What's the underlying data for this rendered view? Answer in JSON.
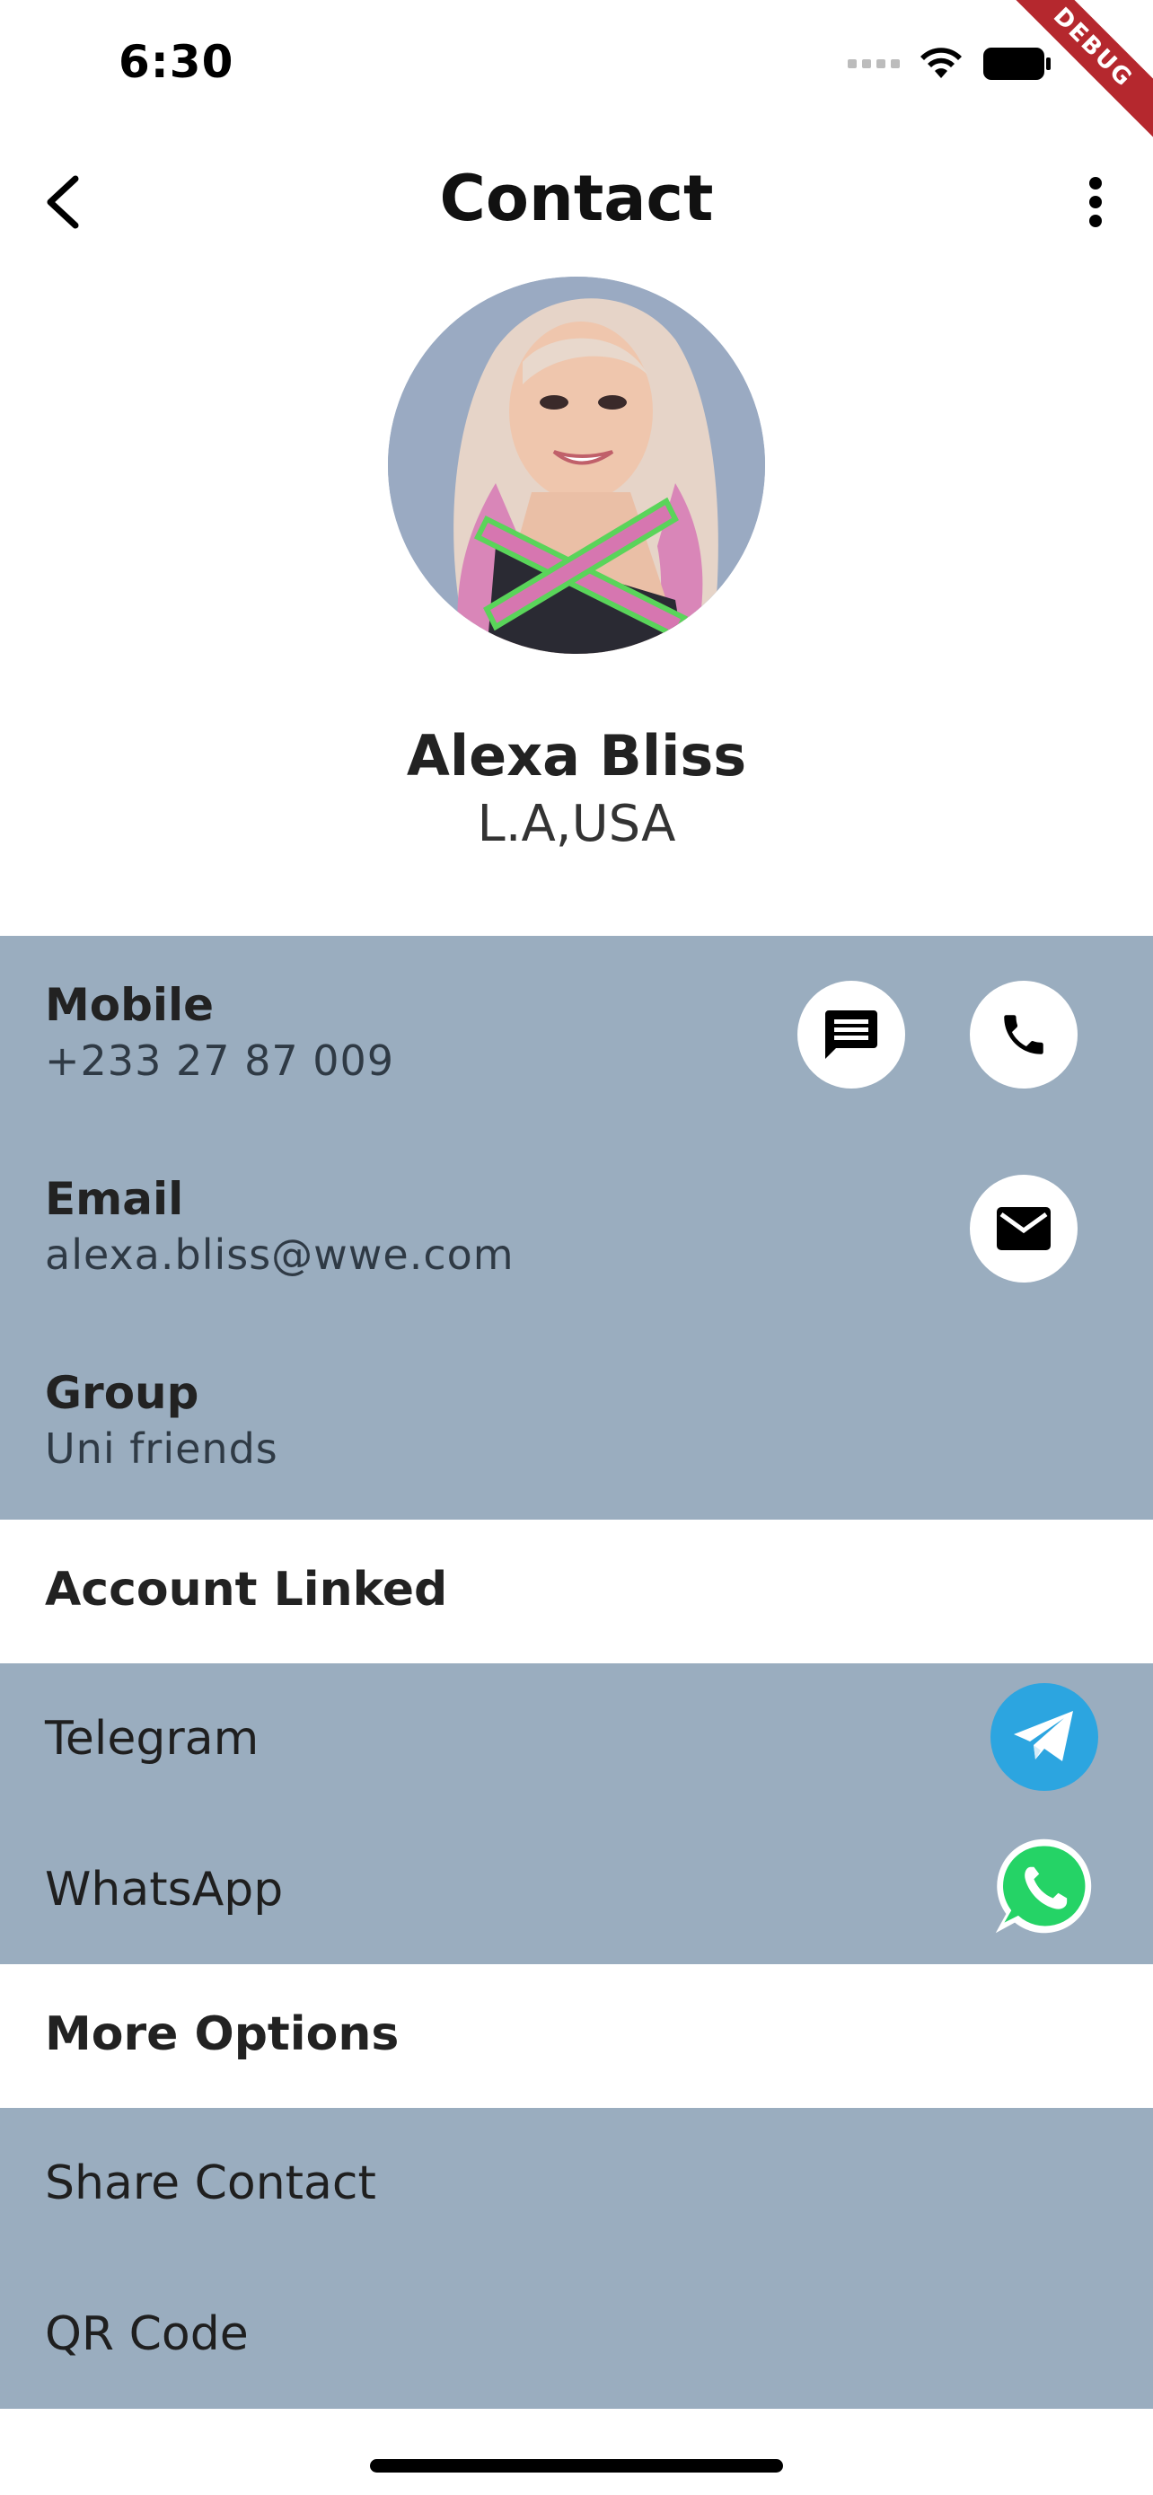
{
  "status_bar": {
    "time": "6:30",
    "debug_label": "DEBUG"
  },
  "app_bar": {
    "title": "Contact"
  },
  "profile": {
    "name": "Alexa Bliss",
    "location": "L.A,USA"
  },
  "details": {
    "mobile_label": "Mobile",
    "mobile_value": "+233 27 87 009",
    "email_label": "Email",
    "email_value": "alexa.bliss@wwe.com",
    "group_label": "Group",
    "group_value": "Uni friends"
  },
  "accounts": {
    "heading": "Account Linked",
    "items": [
      {
        "label": "Telegram",
        "icon": "telegram-icon"
      },
      {
        "label": "WhatsApp",
        "icon": "whatsapp-icon"
      }
    ]
  },
  "more_options": {
    "heading": "More Options",
    "items": [
      {
        "label": "Share Contact"
      },
      {
        "label": "QR Code"
      }
    ]
  },
  "colors": {
    "section_blue": "#9aadbf",
    "telegram_blue": "#2ca5e0",
    "whatsapp_green": "#25d366",
    "debug_red": "#b5282e"
  }
}
